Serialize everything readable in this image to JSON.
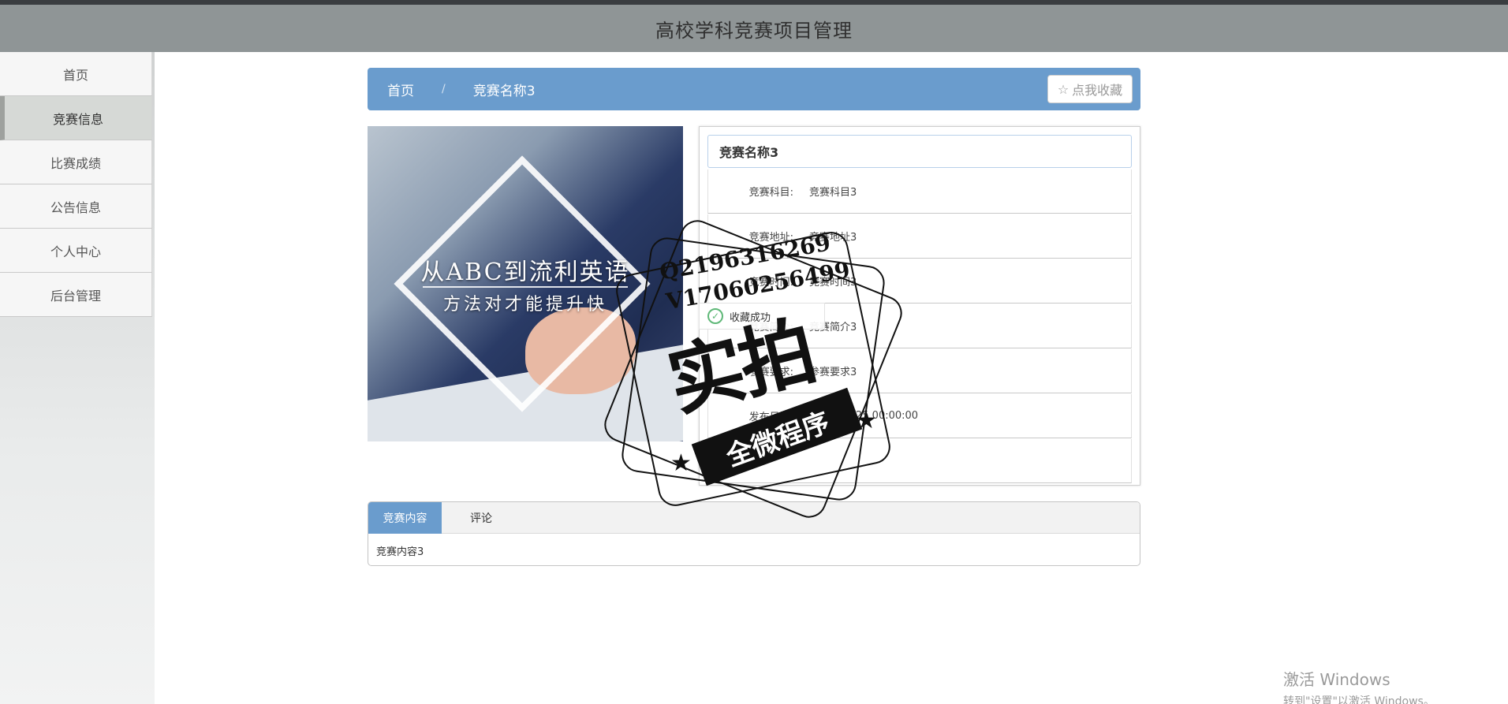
{
  "header": {
    "title": "高校学科竞赛项目管理"
  },
  "sidebar": {
    "items": [
      {
        "label": "首页"
      },
      {
        "label": "竞赛信息",
        "active": true
      },
      {
        "label": "比赛成绩"
      },
      {
        "label": "公告信息"
      },
      {
        "label": "个人中心"
      },
      {
        "label": "后台管理"
      }
    ]
  },
  "breadcrumb": {
    "home": "首页",
    "separator": "/",
    "current": "竞赛名称3"
  },
  "favorite_button": {
    "label": "点我收藏",
    "icon": "star-outline-icon"
  },
  "banner": {
    "line1": "从ABC到流利英语",
    "line2": "方法对才能提升快"
  },
  "detail": {
    "title": "竞赛名称3",
    "rows": [
      {
        "label": "竞赛科目:",
        "value": "竞赛科目3"
      },
      {
        "label": "竞赛地址:",
        "value": "竞赛地址3"
      },
      {
        "label": "竞赛时间:",
        "value": "竞赛时间3"
      },
      {
        "label": "竞赛简介:",
        "value": "竞赛简介3"
      },
      {
        "label": "参赛要求:",
        "value": "参赛要求3"
      },
      {
        "label": "发布日期:",
        "value": "2021-03-25 00:00:00"
      },
      {
        "label": "",
        "value": ""
      }
    ]
  },
  "toast": {
    "message": "收藏成功"
  },
  "tabs": [
    {
      "label": "竞赛内容",
      "active": true
    },
    {
      "label": "评论"
    }
  ],
  "tab_content": "竞赛内容3",
  "watermark": {
    "qq": "Q2196316269",
    "wx": "V17060256499",
    "big": "实拍",
    "ribbon": "全微程序"
  },
  "system": {
    "activation_title": "激活 Windows",
    "activation_sub": "转到\"设置\"以激活 Windows。"
  },
  "colors": {
    "header_bg": "#8f9596",
    "accent": "#6a9ccd",
    "sidebar_active": "#d6d9d6"
  }
}
